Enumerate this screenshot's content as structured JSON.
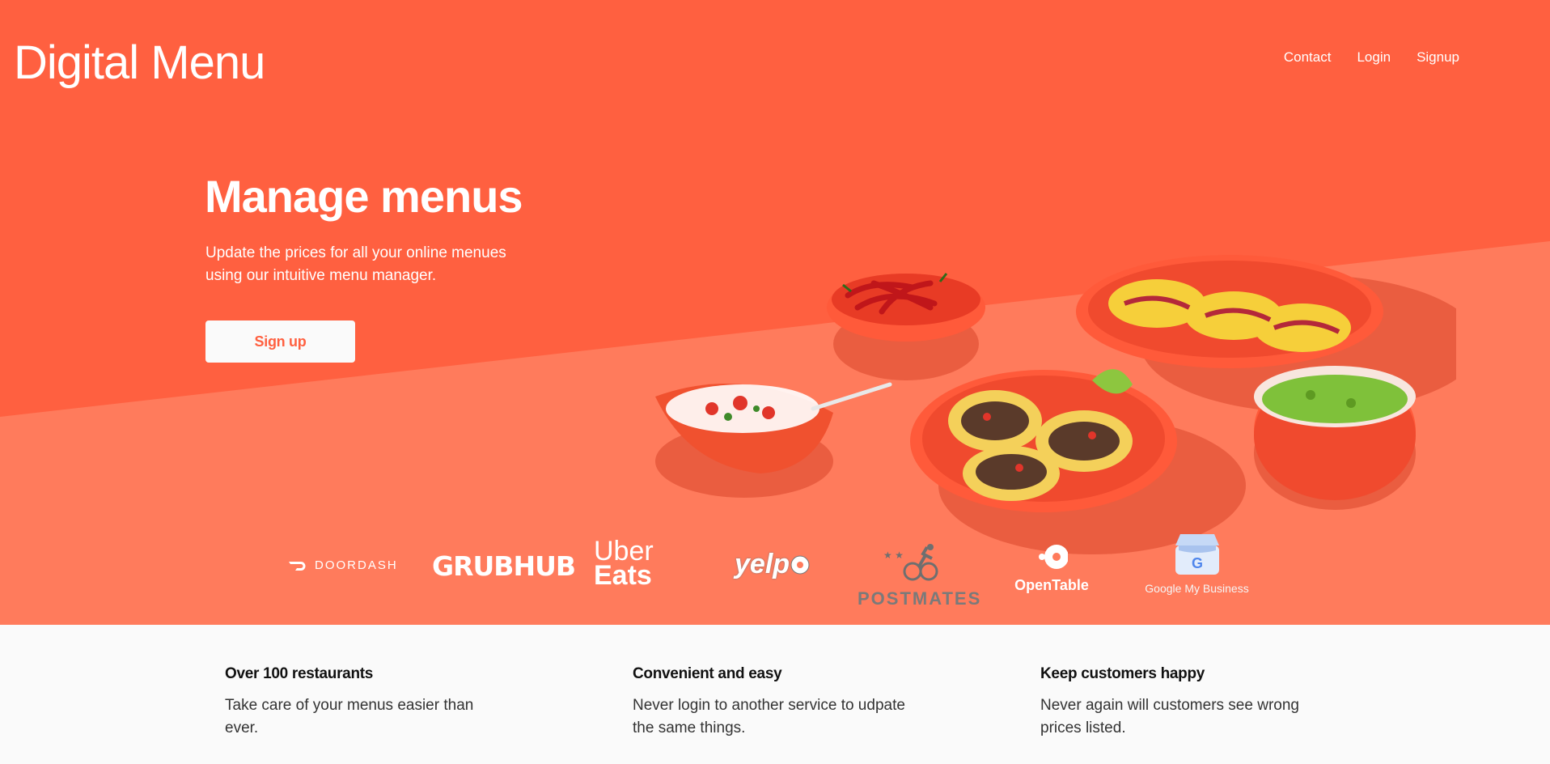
{
  "header": {
    "brand": "Digital Menu",
    "nav": [
      {
        "label": "Contact"
      },
      {
        "label": "Login"
      },
      {
        "label": "Signup"
      }
    ]
  },
  "hero": {
    "headline": "Manage menus",
    "subtext": "Update the prices for all your online menues using our intuitive menu manager.",
    "cta_label": "Sign up",
    "colors": {
      "primary": "#ff6040",
      "secondary": "#ff7b5c",
      "light": "#fafafa"
    }
  },
  "partners": {
    "doordash": "DOORDASH",
    "grubhub": "GRUBHUB",
    "uber_line1": "Uber",
    "uber_line2": "Eats",
    "yelp": "yelp",
    "postmates": "POSTMATES",
    "opentable": "OpenTable",
    "gmb": "Google My Business"
  },
  "features": [
    {
      "title": "Over 100 restaurants",
      "text": "Take care of your menus easier than ever."
    },
    {
      "title": "Convenient and easy",
      "text": "Never login to another service to udpate the same things."
    },
    {
      "title": "Keep customers happy",
      "text": "Never again will customers see wrong prices listed."
    }
  ]
}
